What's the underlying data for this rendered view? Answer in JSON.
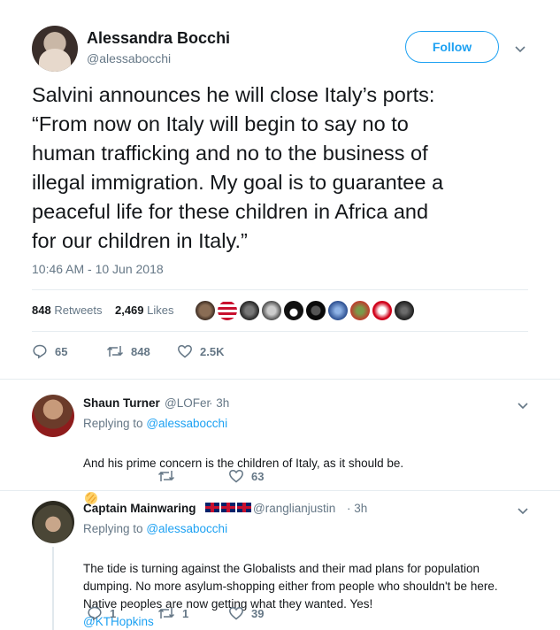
{
  "tweet": {
    "author_name": "Alessandra Bocchi",
    "author_handle": "@alessabocchi",
    "follow_label": "Follow",
    "text": "Salvini announces he will close Italy’s ports:\n“From now on Italy will begin to say no to\nhuman trafficking and no to the business of\nillegal immigration. My goal is to guarantee a\npeaceful life for these children in Africa and\nfor our children in Italy.”",
    "timestamp": "10:46 AM - 10 Jun 2018",
    "retweets_count": "848",
    "retweets_label": "Retweets",
    "likes_count": "2,469",
    "likes_label": "Likes",
    "actions": {
      "reply": "65",
      "retweet": "848",
      "like": "2.5K"
    }
  },
  "colors": {
    "accent": "#1da1f2",
    "secondary_text": "#657786",
    "divider": "#e6ecf0"
  },
  "replies": [
    {
      "name": "Shaun Turner",
      "handle": "@LOFer",
      "time": "· 3h",
      "replying_prefix": "Replying to",
      "replying_to": "@alessabocchi",
      "text": "And his prime concern is the children of Italy, as it should be.",
      "emoji": "clapping-hands-icon",
      "actions": {
        "reply": "",
        "retweet": "",
        "like": "63"
      }
    },
    {
      "name": "Captain Mainwaring",
      "flags": "🇬🇧🇬🇧🇬🇧",
      "handle": "@ranglianjustin",
      "time": "· 3h",
      "replying_prefix": "Replying to",
      "replying_to": "@alessabocchi",
      "text": "The tide is turning against the Globalists and their mad plans for population\ndumping. No more asylum-shopping either from people who shouldn't be here.\nNative peoples are now getting what they wanted. Yes!",
      "mention": "@KTHopkins",
      "actions": {
        "reply": "1",
        "retweet": "1",
        "like": "39"
      }
    }
  ]
}
